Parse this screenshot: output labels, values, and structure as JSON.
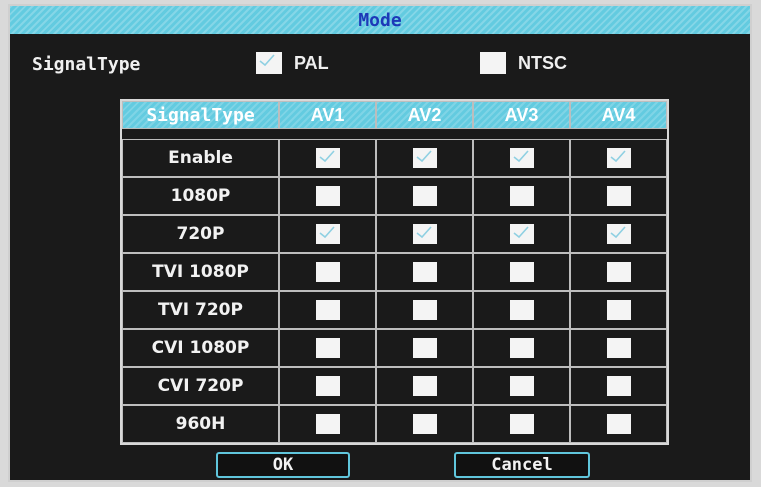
{
  "dialog": {
    "title": "Mode"
  },
  "signal": {
    "label": "SignalType",
    "pal": {
      "label": "PAL",
      "checked": true
    },
    "ntsc": {
      "label": "NTSC",
      "checked": false
    }
  },
  "table": {
    "headers": [
      "SignalType",
      "AV1",
      "AV2",
      "AV3",
      "AV4"
    ],
    "rows": [
      {
        "label": "Enable",
        "checks": [
          true,
          true,
          true,
          true
        ]
      },
      {
        "label": "1080P",
        "checks": [
          false,
          false,
          false,
          false
        ]
      },
      {
        "label": "720P",
        "checks": [
          true,
          true,
          true,
          true
        ]
      },
      {
        "label": "TVI 1080P",
        "checks": [
          false,
          false,
          false,
          false
        ]
      },
      {
        "label": "TVI 720P",
        "checks": [
          false,
          false,
          false,
          false
        ]
      },
      {
        "label": "CVI 1080P",
        "checks": [
          false,
          false,
          false,
          false
        ]
      },
      {
        "label": "CVI 720P",
        "checks": [
          false,
          false,
          false,
          false
        ]
      },
      {
        "label": "960H",
        "checks": [
          false,
          false,
          false,
          false
        ]
      }
    ]
  },
  "buttons": {
    "ok": "OK",
    "cancel": "Cancel"
  },
  "colors": {
    "accent": "#63cbe0",
    "title_text": "#1d39b8",
    "background": "#1a1a1a",
    "check": "#8fd0e2"
  }
}
